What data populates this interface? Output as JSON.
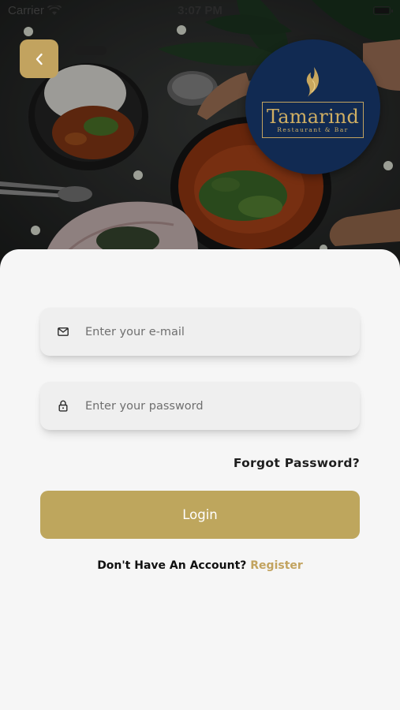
{
  "status_bar": {
    "carrier": "Carrier",
    "time": "3:07 PM"
  },
  "header": {
    "back_icon": "chevron-left-icon",
    "logo": {
      "name": "Tamarind",
      "subtitle": "Restaurant & Bar"
    }
  },
  "login_form": {
    "email": {
      "icon": "mail-icon",
      "value": "",
      "placeholder": "Enter your e-mail"
    },
    "password": {
      "icon": "lock-icon",
      "value": "",
      "placeholder": "Enter your password"
    },
    "forgot_label": "Forgot Password?",
    "login_label": "Login",
    "register_prompt": "Don't Have An Account?",
    "register_label": "Register"
  },
  "colors": {
    "accent": "#c2a35f",
    "logo_background": "#112a52",
    "page_background": "#f6f6f6",
    "field_background": "#efefef"
  }
}
